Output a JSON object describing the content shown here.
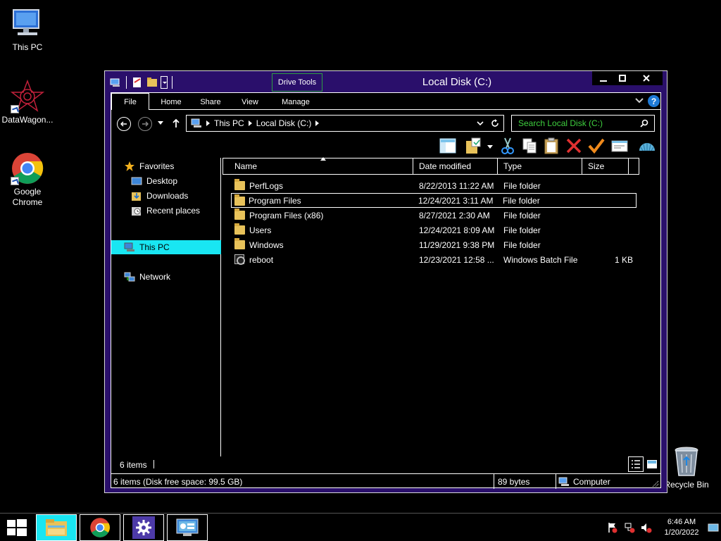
{
  "desktop": {
    "icons": [
      {
        "label": "This PC"
      },
      {
        "label": "DataWagon..."
      },
      {
        "label": "Google Chrome"
      },
      {
        "label": "Recycle Bin"
      }
    ]
  },
  "window": {
    "title": "Local Disk (C:)",
    "drive_tools": "Drive Tools",
    "controls": {
      "minimize": "—",
      "maximize": "□",
      "close": "✕"
    },
    "tabs": [
      {
        "label": "File"
      },
      {
        "label": "Home"
      },
      {
        "label": "Share"
      },
      {
        "label": "View"
      },
      {
        "label": "Manage"
      }
    ],
    "help": "?",
    "address": {
      "crumbs": [
        "This PC",
        "Local Disk (C:)"
      ]
    },
    "search": {
      "placeholder": "Search Local Disk (C:)"
    },
    "nav_pane": {
      "favorites": "Favorites",
      "favorites_items": [
        "Desktop",
        "Downloads",
        "Recent places"
      ],
      "this_pc": "This PC",
      "network": "Network"
    },
    "columns": {
      "name": "Name",
      "date": "Date modified",
      "type": "Type",
      "size": "Size"
    },
    "files": [
      {
        "name": "PerfLogs",
        "date": "8/22/2013 11:22 AM",
        "type": "File folder",
        "size": "",
        "icon": "folder-icon"
      },
      {
        "name": "Program Files",
        "date": "12/24/2021 3:11 AM",
        "type": "File folder",
        "size": "",
        "icon": "folder-icon"
      },
      {
        "name": "Program Files (x86)",
        "date": "8/27/2021 2:30 AM",
        "type": "File folder",
        "size": "",
        "icon": "folder-icon"
      },
      {
        "name": "Users",
        "date": "12/24/2021 8:09 AM",
        "type": "File folder",
        "size": "",
        "icon": "folder-icon"
      },
      {
        "name": "Windows",
        "date": "11/29/2021 9:38 PM",
        "type": "File folder",
        "size": "",
        "icon": "folder-icon"
      },
      {
        "name": "reboot",
        "date": "12/23/2021 12:58 ...",
        "type": "Windows Batch File",
        "size": "1 KB",
        "icon": "batch-file-icon"
      }
    ],
    "item_count": "6 items",
    "status": {
      "free_space": "6 items (Disk free space: 99.5 GB)",
      "bytes": "89 bytes",
      "location": "Computer"
    }
  },
  "taskbar": {
    "time": "6:46 AM",
    "date": "1/20/2022"
  },
  "colors": {
    "window_frame": "#2a0f6b",
    "selection": "#19e6f2",
    "search_text": "#3ecf3e",
    "drive_tools_border": "#2ea043"
  }
}
